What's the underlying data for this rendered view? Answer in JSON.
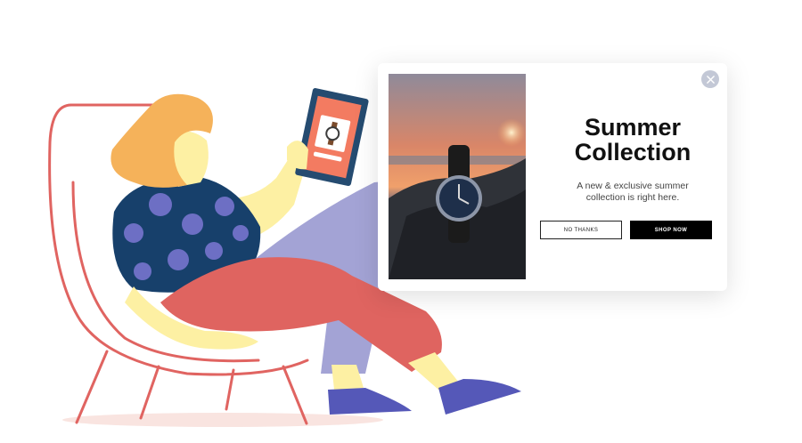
{
  "popup": {
    "title_line1": "Summer",
    "title_line2": "Collection",
    "subtitle_line1": "A new & exclusive summer",
    "subtitle_line2": "collection is right here.",
    "no_thanks_label": "NO THANKS",
    "shop_now_label": "SHOP NOW",
    "close_icon": "close-icon"
  },
  "colors": {
    "chair": "#e06461",
    "hair": "#f5b25a",
    "skin": "#fdf0a3",
    "shirt": "#17406b",
    "shirt_dots": "#6d6fc4",
    "trousers_dark": "#df6460",
    "trousers_light": "#a3a3d5",
    "shoes": "#5558b8",
    "tablet": "#254b70",
    "tablet_screen": "#f37b61",
    "shop_now_bg": "#000000",
    "close_bg": "#c3c8d6"
  }
}
